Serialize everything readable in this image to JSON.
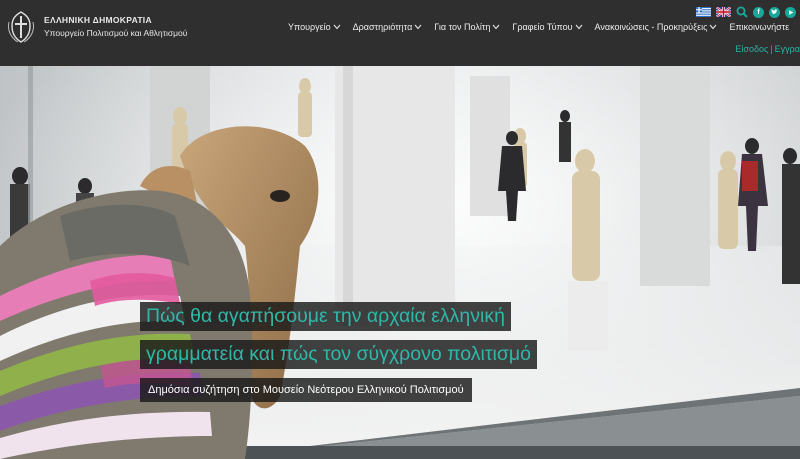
{
  "header": {
    "brand_title": "ΕΛΛΗΝΙΚΗ ΔΗΜΟΚΡΑΤΙΑ",
    "brand_subtitle": "Υπουργείο Πολιτισμού και Αθλητισμού",
    "nav": [
      {
        "label": "Υπουργείο"
      },
      {
        "label": "Δραστηριότητα"
      },
      {
        "label": "Για τον Πολίτη"
      },
      {
        "label": "Γραφείο Τύπου"
      },
      {
        "label": "Ανακοινώσεις - Προκηρύξεις"
      },
      {
        "label": "Επικοινωνήστε"
      }
    ],
    "login": "Είσοδος",
    "register": "Εγγρα",
    "separator": "|",
    "icons": [
      "greek-flag",
      "uk-flag",
      "search",
      "facebook",
      "twitter",
      "youtube"
    ],
    "accent_color": "#18a89a"
  },
  "hero": {
    "headline_line1": "Πώς θα αγαπήσουμε την αρχαία ελληνική",
    "headline_line2": "γραμματεία και πώς τον σύγχρονο πολιτισμό",
    "subheadline": "Δημόσια συζήτηση στο Μουσείο Νεότερου Ελληνικού Πολιτισμού"
  }
}
